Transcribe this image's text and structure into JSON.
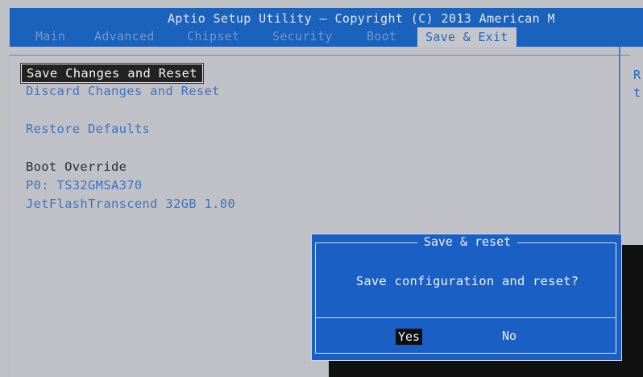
{
  "header": {
    "title": "Aptio Setup Utility – Copyright (C) 2013 American M",
    "tabs": [
      {
        "label": "Main"
      },
      {
        "label": "Advanced"
      },
      {
        "label": "Chipset"
      },
      {
        "label": "Security"
      },
      {
        "label": "Boot"
      },
      {
        "label": "Save & Exit"
      }
    ]
  },
  "menu": {
    "save_changes_reset": "Save Changes and Reset",
    "discard_changes_reset": "Discard Changes and Reset",
    "restore_defaults": "Restore Defaults",
    "boot_override": "Boot Override",
    "boot_device_1": "P0: TS32GMSA370",
    "boot_device_2": "JetFlashTranscend 32GB 1.00"
  },
  "help": {
    "line1": "R",
    "line2": "t"
  },
  "dialog": {
    "title": "Save & reset",
    "message": "Save configuration and reset?",
    "yes": "Yes",
    "no": "No"
  },
  "colors": {
    "header_bg": "#1b62bc",
    "body_bg": "#c0c1c6",
    "dialog_bg": "#1a5fc4"
  }
}
